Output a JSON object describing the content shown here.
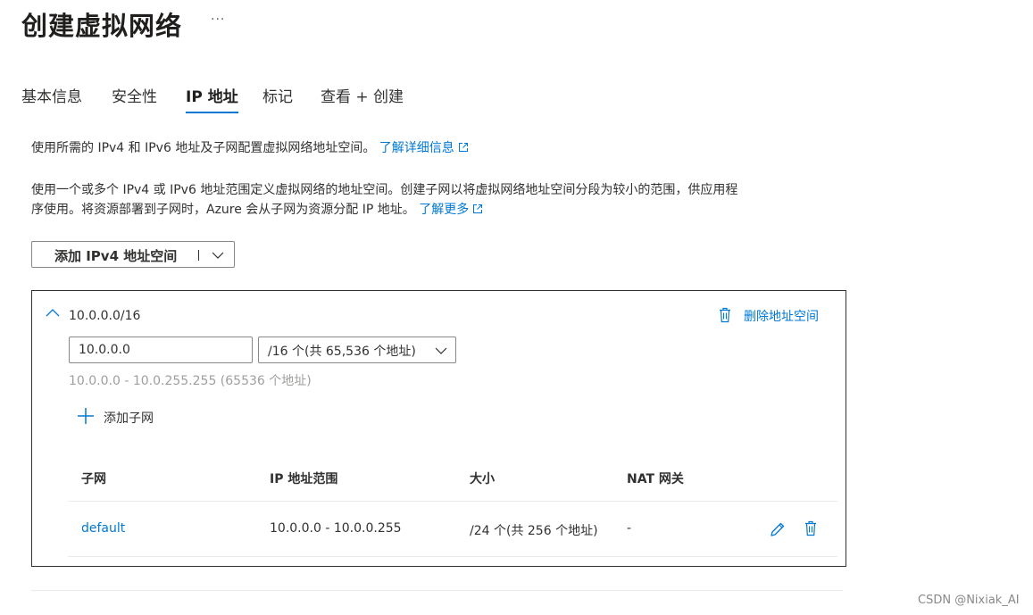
{
  "page": {
    "title": "创建虚拟网络",
    "more_label": "···"
  },
  "tabs": [
    {
      "label": "基本信息",
      "active": false
    },
    {
      "label": "安全性",
      "active": false
    },
    {
      "label": "IP 地址",
      "active": true
    },
    {
      "label": "标记",
      "active": false
    },
    {
      "label": "查看 + 创建",
      "active": false
    }
  ],
  "description": {
    "line1": "使用所需的 IPv4 和 IPv6 地址及子网配置虚拟网络地址空间。",
    "line1_link": "了解详细信息",
    "line2a": "使用一个或多个 IPv4 或 IPv6 地址范围定义虚拟网络的地址空间。创建子网以将虚拟网络地址空间分段为较小的范围，供应用程",
    "line2b": "序使用。将资源部署到子网时，Azure 会从子网为资源分配 IP 地址。",
    "line2_link": "了解更多"
  },
  "add_space_button": {
    "label": "添加 IPv4 地址空间"
  },
  "address_space": {
    "cidr": "10.0.0.0/16",
    "delete_label": "删除地址空间",
    "start_ip": "10.0.0.0",
    "prefix_selected": "/16 个(共 65,536 个地址)",
    "range_hint": "10.0.0.0 - 10.0.255.255 (65536 个地址)",
    "add_subnet_label": "添加子网"
  },
  "subnet_table": {
    "columns": [
      "子网",
      "IP 地址范围",
      "大小",
      "NAT 网关"
    ],
    "rows": [
      {
        "name": "default",
        "range": "10.0.0.0 - 10.0.0.255",
        "size": "/24 个(共 256 个地址)",
        "nat": "-"
      }
    ]
  },
  "watermark": "CSDN @Nixiak_AI",
  "colors": {
    "accent": "#0078d4",
    "text": "#323130",
    "muted": "#a19f9d",
    "border": "#8a8886"
  }
}
